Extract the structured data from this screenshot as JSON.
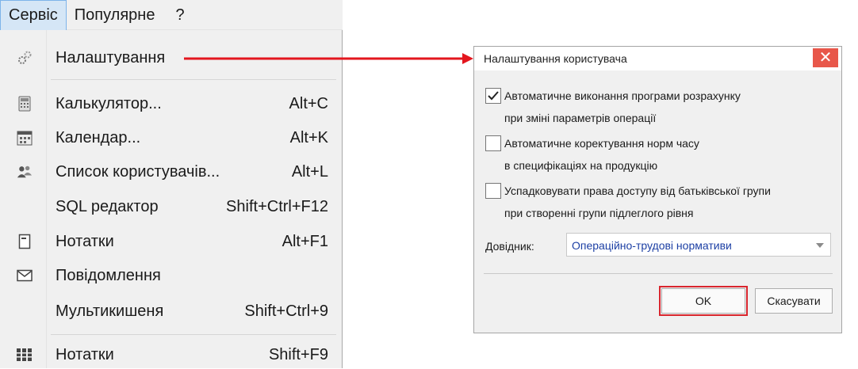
{
  "menubar": {
    "items": [
      "Сервіс",
      "Популярне"
    ],
    "help": "?"
  },
  "menu": {
    "items": [
      {
        "label": "Налаштування",
        "shortcut": "",
        "icon": "gears-icon"
      },
      {
        "label": "Калькулятор...",
        "shortcut": "Alt+C",
        "icon": "calculator-icon"
      },
      {
        "label": "Календар...",
        "shortcut": "Alt+K",
        "icon": "calendar-icon"
      },
      {
        "label": "Список користувачів...",
        "shortcut": "Alt+L",
        "icon": "users-icon"
      },
      {
        "label": "SQL редактор",
        "shortcut": "Shift+Ctrl+F12",
        "icon": ""
      },
      {
        "label": "Нотатки",
        "shortcut": "Alt+F1",
        "icon": "note-icon"
      },
      {
        "label": "Повідомлення",
        "shortcut": "",
        "icon": "envelope-icon"
      },
      {
        "label": "Мультикишеня",
        "shortcut": "Shift+Ctrl+9",
        "icon": ""
      },
      {
        "label": "Нотатки",
        "shortcut": "Shift+F9",
        "icon": "grid-notes-icon"
      }
    ]
  },
  "dialog": {
    "title": "Налаштування користувача",
    "close": "✕",
    "options": [
      {
        "line1": "Автоматичне виконання програми розрахунку",
        "line2": "при зміні параметрів операції",
        "checked": true
      },
      {
        "line1": "Автоматичне коректування норм часу",
        "line2": "в специфікаціях на продукцію",
        "checked": false
      },
      {
        "line1": "Успадковувати права доступу від батьківської групи",
        "line2": "при створенні групи підлеглого рівня",
        "checked": false
      }
    ],
    "directory_label": "Довідник:",
    "directory_value": "Операційно-трудові нормативи",
    "ok": "OK",
    "cancel": "Скасувати"
  },
  "colors": {
    "arrow": "#e3161e",
    "highlight": "#d9262e",
    "close_bg": "#e8574a",
    "menu_active_bg": "#d5e6f6"
  }
}
